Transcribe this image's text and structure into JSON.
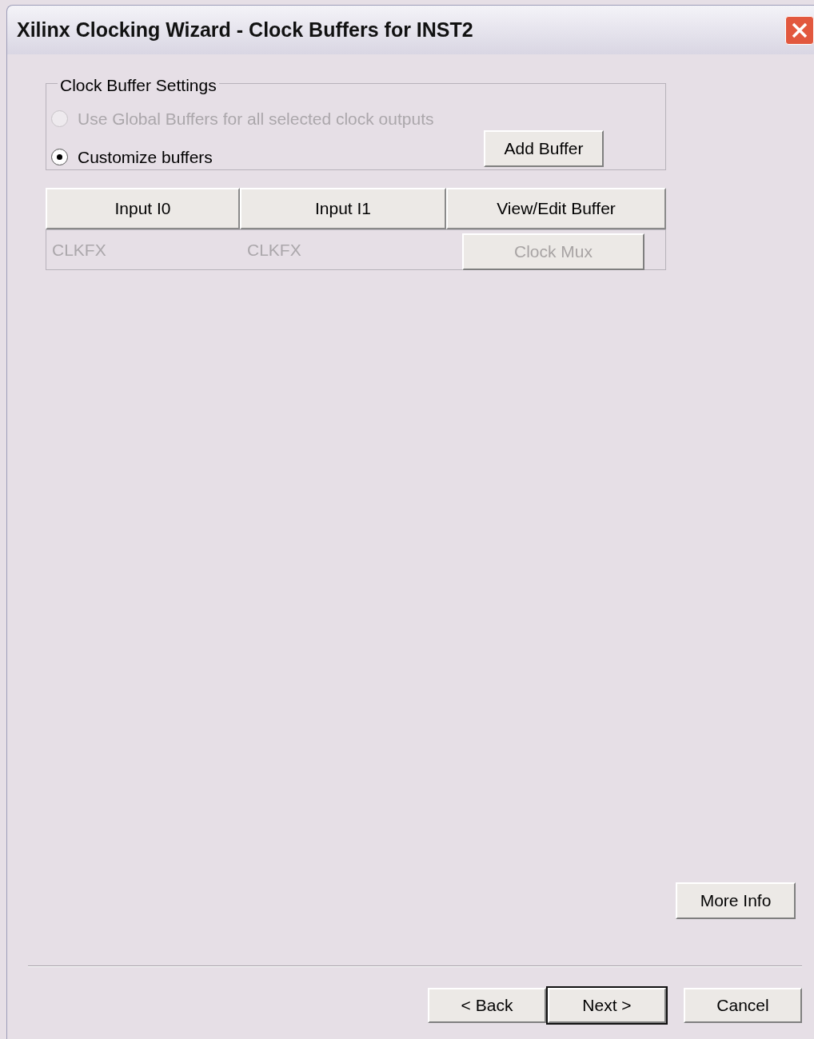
{
  "window": {
    "title": "Xilinx Clocking Wizard - Clock Buffers for INST2"
  },
  "group": {
    "title": "Clock Buffer Settings",
    "options": [
      {
        "label": "Use Global Buffers for all selected clock outputs",
        "selected": false,
        "disabled": true
      },
      {
        "label": "Customize buffers",
        "selected": true,
        "disabled": false
      }
    ],
    "add_button": {
      "label": "Add Buffer",
      "disabled": false
    }
  },
  "table": {
    "columns": [
      "Input I0",
      "Input I1",
      "View/Edit Buffer"
    ],
    "rows": [
      {
        "input_i0": "CLKFX",
        "input_i1": "CLKFX",
        "button": {
          "label": "Clock Mux",
          "disabled": true
        },
        "disabled": true
      }
    ]
  },
  "more_info": {
    "label": "More Info",
    "disabled": false
  },
  "buttons": [
    {
      "label": "< Back",
      "default": false
    },
    {
      "label": "Next >",
      "default": true
    },
    {
      "label": "Cancel",
      "default": false
    }
  ]
}
